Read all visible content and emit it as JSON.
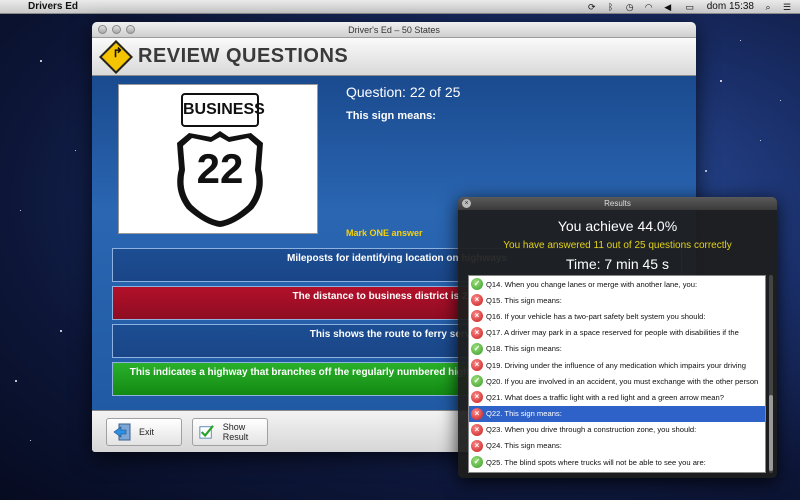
{
  "menubar": {
    "app_name": "Drivers Ed",
    "clock": "dom 15:38"
  },
  "window": {
    "title": "Driver's Ed – 50 States",
    "header_title": "REVIEW QUESTIONS"
  },
  "question": {
    "number_text": "Question: 22 of 25",
    "prompt": "This sign means:",
    "instruction": "Mark ONE answer",
    "sign": {
      "plate_text": "BUSINESS",
      "route_number": "22"
    },
    "answers": [
      {
        "text": "Mileposts for identifying location on highways",
        "state": "neutral"
      },
      {
        "text": "The distance to business district is 22 miles",
        "state": "wrong"
      },
      {
        "text": "This shows the route to ferry service",
        "state": "neutral"
      },
      {
        "text": "This indicates a highway that branches off the regularly numbered highway through the business part of the city",
        "state": "correct"
      }
    ]
  },
  "footer": {
    "exit_label": "Exit",
    "show_result_label": "Show Result"
  },
  "results": {
    "title": "Results",
    "score_text": "You achieve 44.0%",
    "answered_text": "You have answered 11 out of 25 questions correctly",
    "time_text": "Time: 7 min 45 s",
    "items": [
      {
        "text": "Q14. When you change lanes or merge with another lane, you:",
        "correct": true
      },
      {
        "text": "Q15. This sign means:",
        "correct": false
      },
      {
        "text": "Q16. If your vehicle has a two-part safety belt system you should:",
        "correct": false
      },
      {
        "text": "Q17. A driver may park in a space reserved for people with disabilities if the",
        "correct": false
      },
      {
        "text": "Q18. This sign means:",
        "correct": true
      },
      {
        "text": "Q19. Driving under the influence of any medication which impairs your driving",
        "correct": false
      },
      {
        "text": "Q20. If you are involved in an accident, you must exchange with the other person",
        "correct": true
      },
      {
        "text": "Q21. What does a traffic light with a red light and a green arrow mean?",
        "correct": false
      },
      {
        "text": "Q22. This sign means:",
        "correct": false,
        "selected": true
      },
      {
        "text": "Q23. When you drive through a construction zone, you should:",
        "correct": false
      },
      {
        "text": "Q24. This sign means:",
        "correct": false
      },
      {
        "text": "Q25. The blind spots where trucks will not be able to see you are:",
        "correct": true
      }
    ]
  },
  "colors": {
    "content_blue": "#215aa4",
    "wrong_red": "#b3102a",
    "correct_green": "#2ab02a",
    "highlight_yellow": "#f5d20a",
    "selection_blue": "#2f62c9"
  }
}
